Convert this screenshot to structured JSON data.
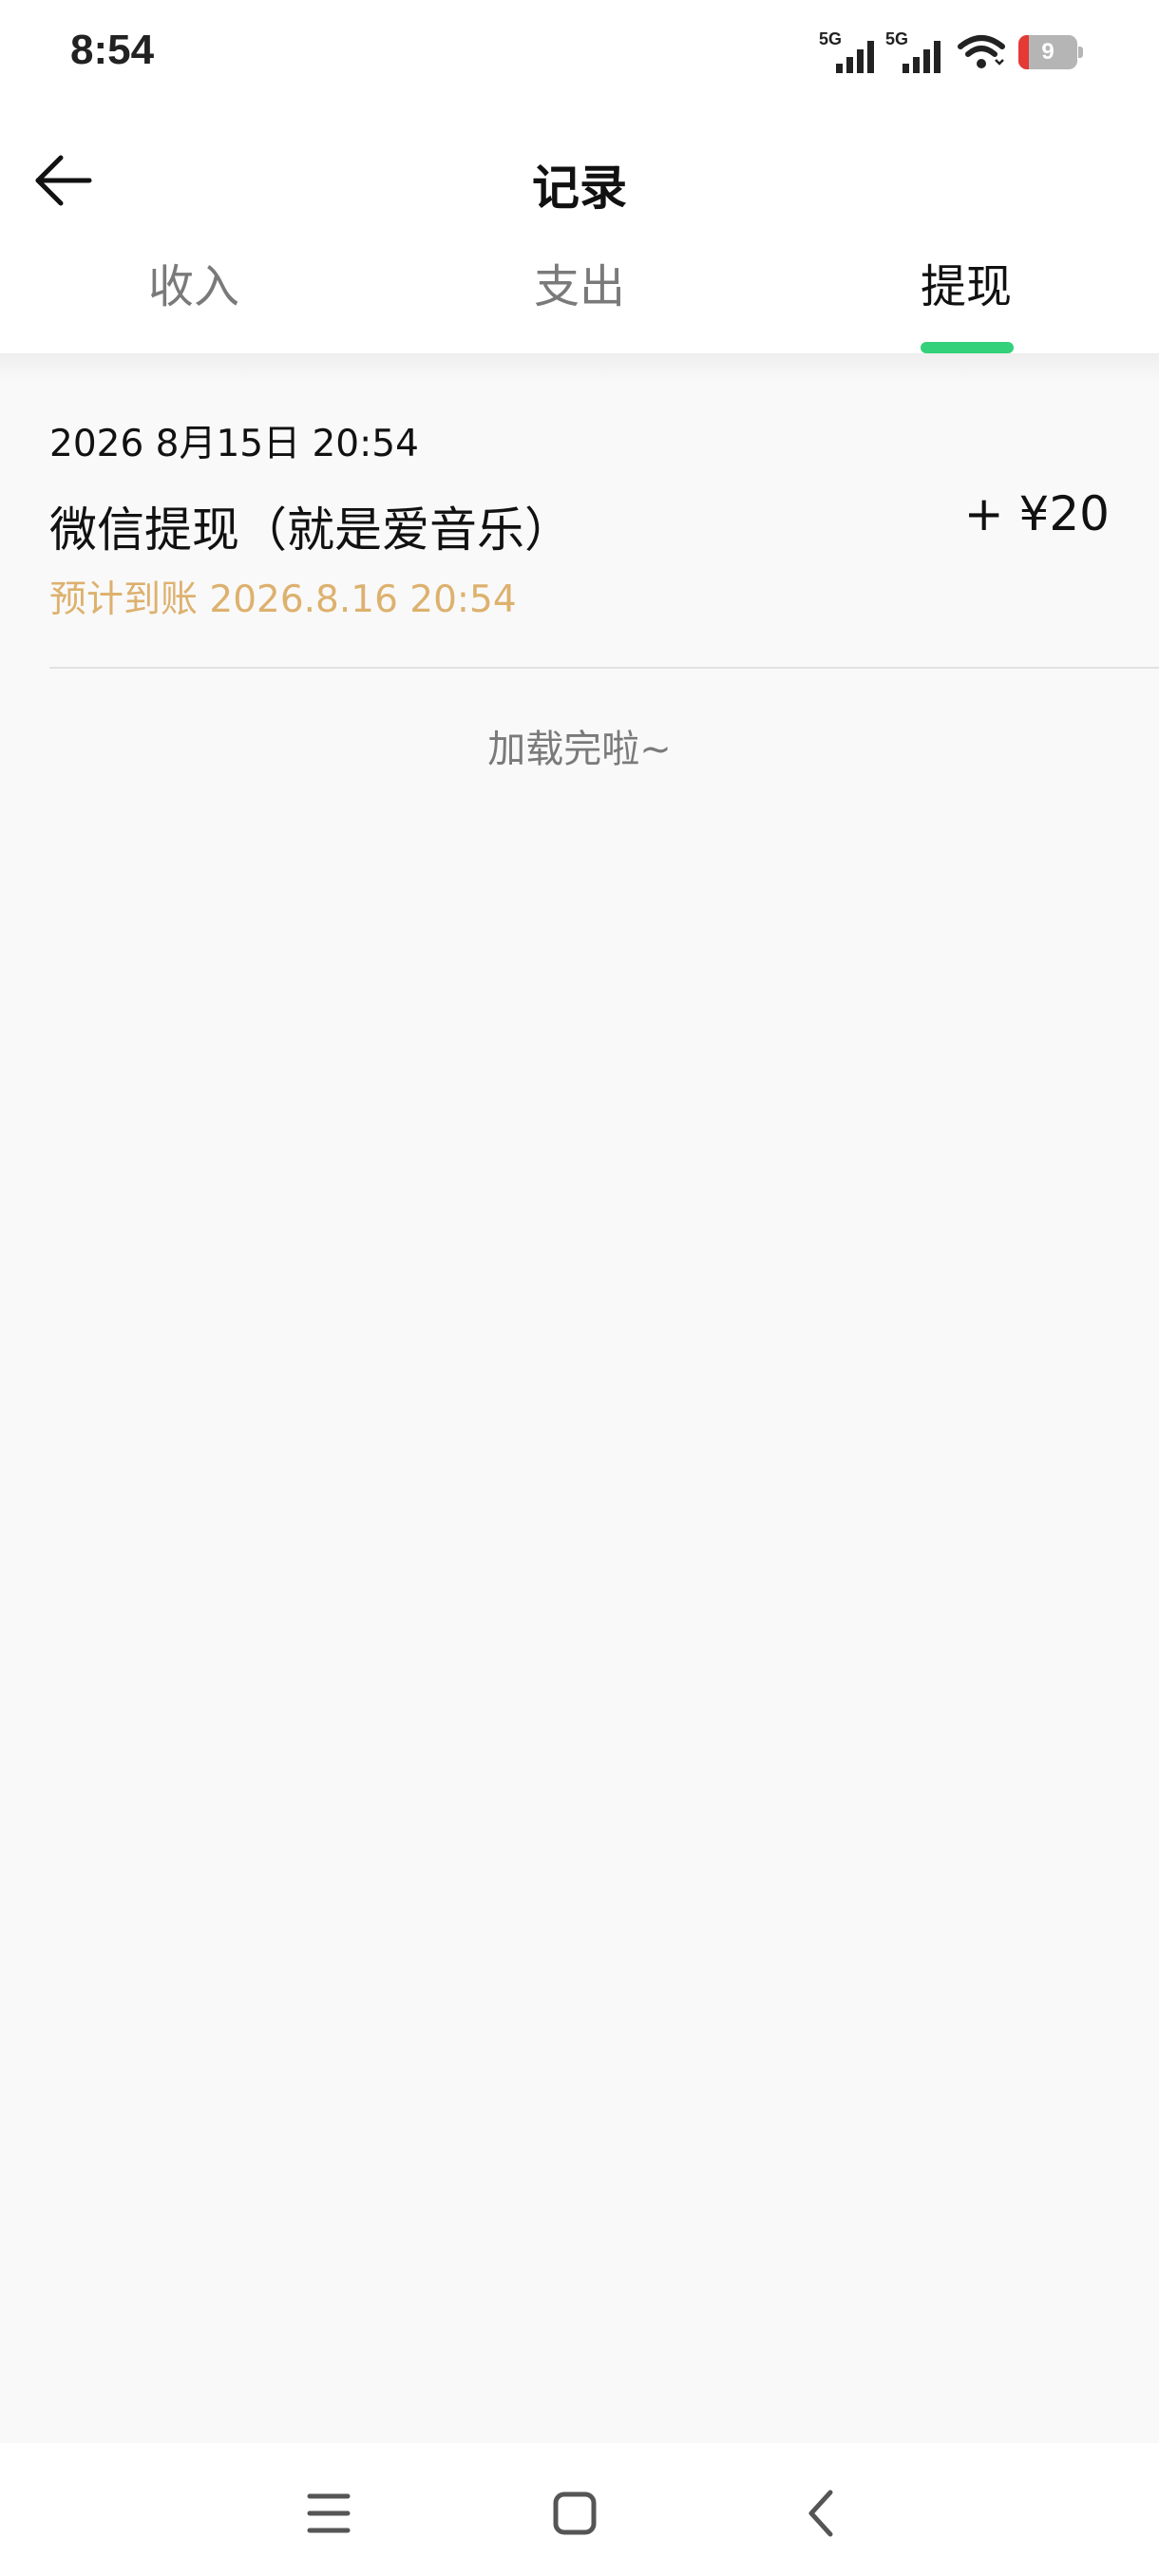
{
  "status_bar": {
    "time": "8:54",
    "signal_1_label": "5G",
    "signal_2_label": "5G",
    "battery_level": "9",
    "icons": [
      "signal-5g-icon",
      "signal-5g-icon",
      "wifi-icon",
      "battery-icon"
    ],
    "battery_low_color": "#e53935"
  },
  "header": {
    "title": "记录",
    "back_icon": "arrow-left-icon"
  },
  "tabs": [
    {
      "label": "收入",
      "active": false
    },
    {
      "label": "支出",
      "active": false
    },
    {
      "label": "提现",
      "active": true
    }
  ],
  "accent_color": "#33d17a",
  "records": [
    {
      "date": "2026 8月15日 20:54",
      "title": "微信提现（就是爱音乐）",
      "amount": "+ ¥20",
      "expected": "预计到账 2026.8.16 20:54",
      "expected_color": "#ddb16e"
    }
  ],
  "footer_text": "加载完啦~",
  "nav_bar": {
    "icons": [
      "menu-icon",
      "home-square-icon",
      "back-chevron-icon"
    ]
  }
}
